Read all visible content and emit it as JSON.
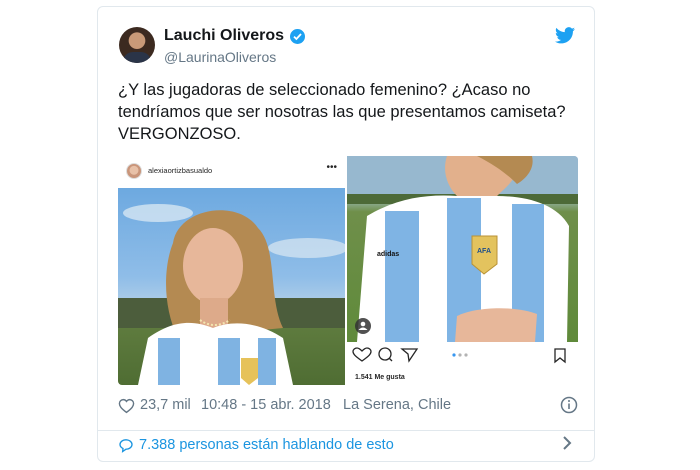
{
  "tweet": {
    "author_name": "Lauchi Oliveros",
    "author_handle": "@LaurinaOliveros",
    "text_line1": "¿Y las jugadoras de seleccionado femenino? ¿Acaso no",
    "text_line2": "tendríamos que ser nosotras las que presentamos camiseta?",
    "text_line3": "VERGONZOSO.",
    "likes": "23,7 mil",
    "timestamp": "10:48 - 15 abr. 2018",
    "location": "La Serena, Chile",
    "conversation": "7.388 personas están hablando de esto"
  },
  "embedded_instagram": {
    "username": "alexiaortizbasualdo",
    "likes_text": "1.541 Me gusta",
    "shirt_brand": "adidas",
    "crest_text": "AFA"
  },
  "colors": {
    "twitter_blue": "#1da1f2",
    "link_blue": "#1b95e0",
    "muted_gray": "#657786",
    "border": "#e1e8ed"
  },
  "icons": [
    "verified-badge-icon",
    "twitter-bird-icon",
    "heart-icon",
    "info-icon",
    "comment-bubble-icon",
    "chevron-right-icon",
    "instagram-heart-icon",
    "instagram-comment-icon",
    "instagram-share-icon",
    "instagram-bookmark-icon",
    "instagram-more-icon",
    "instagram-user-tag-icon"
  ]
}
